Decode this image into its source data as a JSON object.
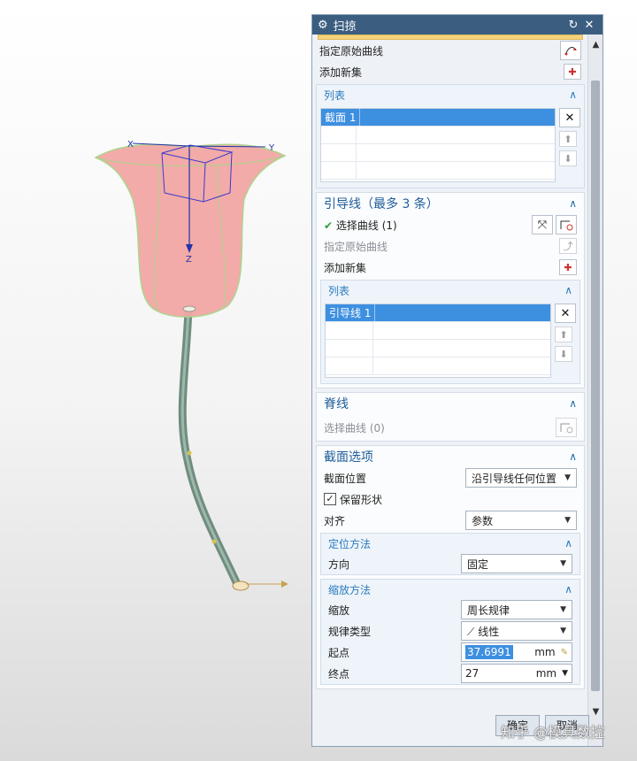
{
  "dialog": {
    "title": "扫掠",
    "section_partial": {
      "specify_original_curve": "指定原始曲线",
      "add_new_set": "添加新集",
      "list_title": "列表",
      "list_items": [
        "截面 1"
      ]
    },
    "guide": {
      "title": "引导线（最多 3 条）",
      "select_curve": "选择曲线 (1)",
      "specify_original_curve": "指定原始曲线",
      "add_new_set": "添加新集",
      "list_title": "列表",
      "list_items": [
        "引导线 1"
      ]
    },
    "spine": {
      "title": "脊线",
      "select_curve": "选择曲线 (0)"
    },
    "section_options": {
      "title": "截面选项",
      "position_label": "截面位置",
      "position_value": "沿引导线任何位置",
      "preserve_shape_label": "保留形状",
      "preserve_shape_checked": true,
      "align_label": "对齐",
      "align_value": "参数",
      "orientation": {
        "title": "定位方法",
        "direction_label": "方向",
        "direction_value": "固定"
      },
      "scaling": {
        "title": "缩放方法",
        "scale_label": "缩放",
        "scale_value": "周长规律",
        "law_type_label": "规律类型",
        "law_type_value": "线性",
        "start_label": "起点",
        "start_value": "37.6991",
        "start_unit": "mm",
        "end_label": "终点",
        "end_value": "27",
        "end_unit": "mm"
      }
    },
    "footer": {
      "ok_label": "确定",
      "cancel_label": "取消"
    }
  },
  "viewport": {
    "axis_x": "X",
    "axis_y": "Y",
    "axis_z": "Z"
  },
  "watermark": "知乎 @模具数控",
  "colors": {
    "titlebar": "#3b5e80",
    "accent": "#1d5c9a",
    "selection": "#3d8fe0",
    "flower": "#f2a7a4",
    "stem": "#7d9a8c"
  }
}
